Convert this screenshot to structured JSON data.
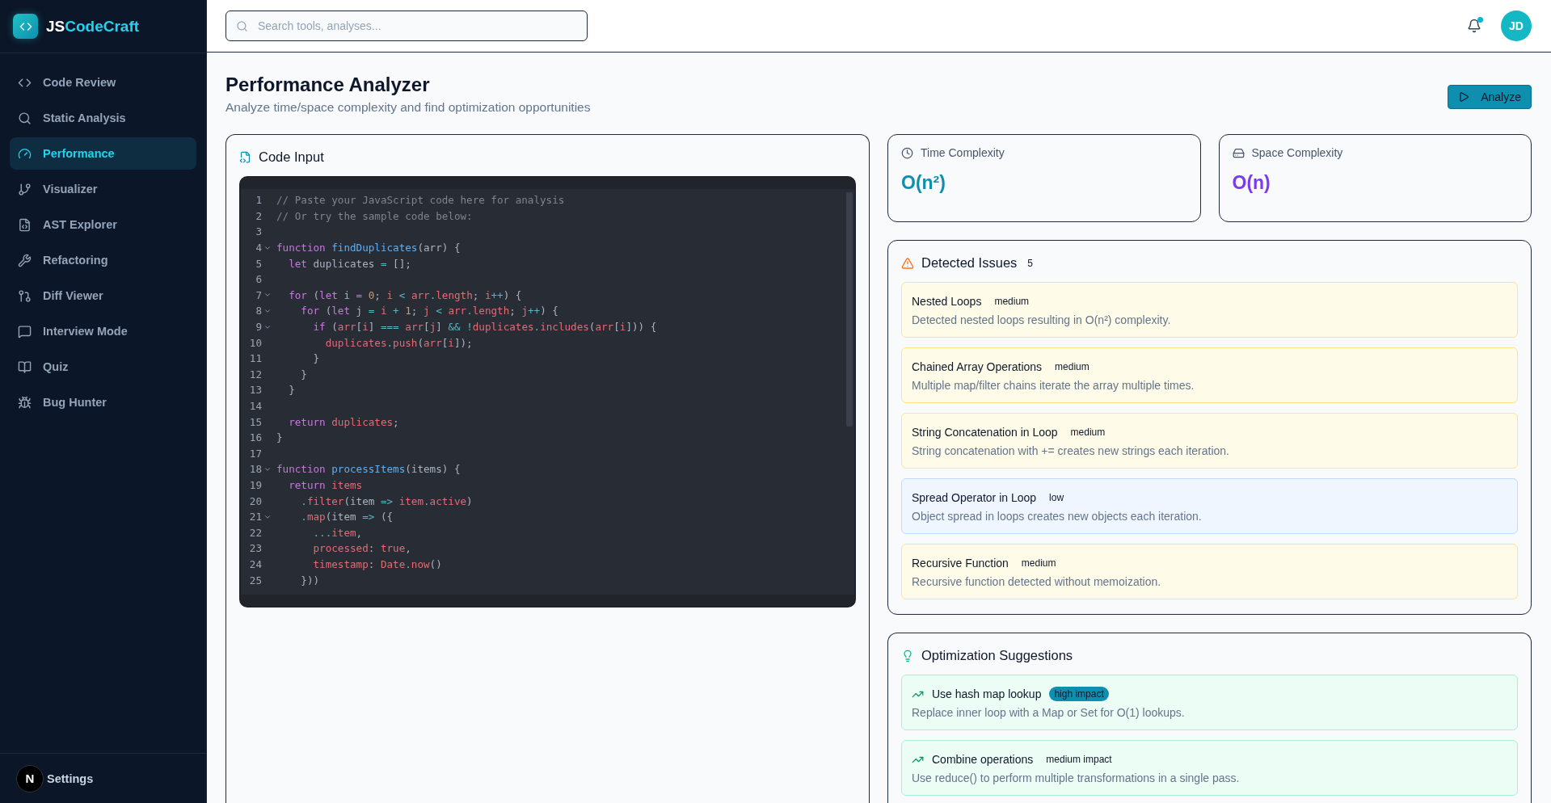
{
  "brand": {
    "prefix": "JS",
    "name": "CodeCraft"
  },
  "nav": [
    {
      "label": "Code Review",
      "selected": false
    },
    {
      "label": "Static Analysis",
      "selected": false
    },
    {
      "label": "Performance",
      "selected": true
    },
    {
      "label": "Visualizer",
      "selected": false
    },
    {
      "label": "AST Explorer",
      "selected": false
    },
    {
      "label": "Refactoring",
      "selected": false
    },
    {
      "label": "Diff Viewer",
      "selected": false
    },
    {
      "label": "Interview Mode",
      "selected": false
    },
    {
      "label": "Quiz",
      "selected": false
    },
    {
      "label": "Bug Hunter",
      "selected": false
    }
  ],
  "settings": {
    "label": "Settings",
    "badge": "N"
  },
  "search": {
    "placeholder": "Search tools, analyses..."
  },
  "notifications": {
    "unread": true
  },
  "avatar": "JD",
  "page": {
    "title": "Performance Analyzer",
    "subtitle": "Analyze time/space complexity and find optimization opportunities",
    "action": "Analyze"
  },
  "code_input": {
    "title": "Code Input",
    "lines": [
      {
        "number": "1",
        "fold": false,
        "tokens": [
          {
            "kind": "c",
            "text": "// Paste your JavaScript code here for analysis"
          }
        ]
      },
      {
        "number": "2",
        "fold": false,
        "tokens": [
          {
            "kind": "c",
            "text": "// Or try the sample code below:"
          }
        ]
      },
      {
        "number": "3",
        "fold": false
      },
      {
        "number": "4",
        "fold": true,
        "tokens": [
          {
            "kind": "k",
            "text": "function "
          },
          {
            "kind": "f",
            "text": "findDuplicates"
          },
          {
            "kind": "p",
            "text": "(arr) {"
          }
        ]
      },
      {
        "number": "5",
        "fold": false,
        "tokens": [
          {
            "kind": "k",
            "text": "  let"
          },
          {
            "kind": "p",
            "text": " duplicates "
          },
          {
            "kind": "o",
            "text": "="
          },
          {
            "kind": "p",
            "text": " [];"
          }
        ]
      },
      {
        "number": "6",
        "fold": false
      },
      {
        "number": "7",
        "fold": true,
        "tokens": [
          {
            "kind": "k",
            "text": "  for"
          },
          {
            "kind": "p",
            "text": " ("
          },
          {
            "kind": "k",
            "text": "let"
          },
          {
            "kind": "p",
            "text": " i "
          },
          {
            "kind": "o",
            "text": "="
          },
          {
            "kind": "n",
            "text": " 0"
          },
          {
            "kind": "p",
            "text": "; "
          },
          {
            "kind": "v",
            "text": "i"
          },
          {
            "kind": "o",
            "text": " < "
          },
          {
            "kind": "v",
            "text": "arr"
          },
          {
            "kind": "o",
            "text": "."
          },
          {
            "kind": "v",
            "text": "length"
          },
          {
            "kind": "p",
            "text": "; "
          },
          {
            "kind": "v",
            "text": "i"
          },
          {
            "kind": "o",
            "text": "++"
          },
          {
            "kind": "p",
            "text": ") {"
          }
        ]
      },
      {
        "number": "8",
        "fold": true,
        "tokens": [
          {
            "kind": "k",
            "text": "    for"
          },
          {
            "kind": "p",
            "text": " ("
          },
          {
            "kind": "k",
            "text": "let"
          },
          {
            "kind": "p",
            "text": " j "
          },
          {
            "kind": "o",
            "text": "="
          },
          {
            "kind": "v",
            "text": " i"
          },
          {
            "kind": "o",
            "text": " + "
          },
          {
            "kind": "n",
            "text": "1"
          },
          {
            "kind": "p",
            "text": "; "
          },
          {
            "kind": "v",
            "text": "j"
          },
          {
            "kind": "o",
            "text": " < "
          },
          {
            "kind": "v",
            "text": "arr"
          },
          {
            "kind": "o",
            "text": "."
          },
          {
            "kind": "v",
            "text": "length"
          },
          {
            "kind": "p",
            "text": "; "
          },
          {
            "kind": "v",
            "text": "j"
          },
          {
            "kind": "o",
            "text": "++"
          },
          {
            "kind": "p",
            "text": ") {"
          }
        ]
      },
      {
        "number": "9",
        "fold": true,
        "tokens": [
          {
            "kind": "k",
            "text": "      if"
          },
          {
            "kind": "p",
            "text": " ("
          },
          {
            "kind": "v",
            "text": "arr"
          },
          {
            "kind": "p",
            "text": "["
          },
          {
            "kind": "v",
            "text": "i"
          },
          {
            "kind": "p",
            "text": "] "
          },
          {
            "kind": "o",
            "text": "=== "
          },
          {
            "kind": "v",
            "text": "arr"
          },
          {
            "kind": "p",
            "text": "["
          },
          {
            "kind": "v",
            "text": "j"
          },
          {
            "kind": "p",
            "text": "] "
          },
          {
            "kind": "o",
            "text": "&& !"
          },
          {
            "kind": "v",
            "text": "duplicates"
          },
          {
            "kind": "o",
            "text": "."
          },
          {
            "kind": "v",
            "text": "includes"
          },
          {
            "kind": "p",
            "text": "("
          },
          {
            "kind": "v",
            "text": "arr"
          },
          {
            "kind": "p",
            "text": "["
          },
          {
            "kind": "v",
            "text": "i"
          },
          {
            "kind": "p",
            "text": "])) {"
          }
        ]
      },
      {
        "number": "10",
        "fold": false,
        "tokens": [
          {
            "kind": "v",
            "text": "        duplicates"
          },
          {
            "kind": "o",
            "text": "."
          },
          {
            "kind": "v",
            "text": "push"
          },
          {
            "kind": "p",
            "text": "("
          },
          {
            "kind": "v",
            "text": "arr"
          },
          {
            "kind": "p",
            "text": "["
          },
          {
            "kind": "v",
            "text": "i"
          },
          {
            "kind": "p",
            "text": "]);"
          }
        ]
      },
      {
        "number": "11",
        "fold": false,
        "tokens": [
          {
            "kind": "p",
            "text": "      }"
          }
        ]
      },
      {
        "number": "12",
        "fold": false,
        "tokens": [
          {
            "kind": "p",
            "text": "    }"
          }
        ]
      },
      {
        "number": "13",
        "fold": false,
        "tokens": [
          {
            "kind": "p",
            "text": "  }"
          }
        ]
      },
      {
        "number": "14",
        "fold": false
      },
      {
        "number": "15",
        "fold": false,
        "tokens": [
          {
            "kind": "k",
            "text": "  return "
          },
          {
            "kind": "v",
            "text": "duplicates"
          },
          {
            "kind": "p",
            "text": ";"
          }
        ]
      },
      {
        "number": "16",
        "fold": false,
        "tokens": [
          {
            "kind": "p",
            "text": "}"
          }
        ]
      },
      {
        "number": "17",
        "fold": false
      },
      {
        "number": "18",
        "fold": true,
        "tokens": [
          {
            "kind": "k",
            "text": "function "
          },
          {
            "kind": "f",
            "text": "processItems"
          },
          {
            "kind": "p",
            "text": "(items) {"
          }
        ]
      },
      {
        "number": "19",
        "fold": false,
        "tokens": [
          {
            "kind": "k",
            "text": "  return "
          },
          {
            "kind": "v",
            "text": "items"
          }
        ]
      },
      {
        "number": "20",
        "fold": false,
        "tokens": [
          {
            "kind": "o",
            "text": "    ."
          },
          {
            "kind": "v",
            "text": "filter"
          },
          {
            "kind": "p",
            "text": "(item "
          },
          {
            "kind": "o",
            "text": "=> "
          },
          {
            "kind": "v",
            "text": "item"
          },
          {
            "kind": "o",
            "text": "."
          },
          {
            "kind": "v",
            "text": "active"
          },
          {
            "kind": "p",
            "text": ")"
          }
        ]
      },
      {
        "number": "21",
        "fold": true,
        "tokens": [
          {
            "kind": "o",
            "text": "    ."
          },
          {
            "kind": "v",
            "text": "map"
          },
          {
            "kind": "p",
            "text": "(item "
          },
          {
            "kind": "o",
            "text": "=>"
          },
          {
            "kind": "p",
            "text": " ({"
          }
        ]
      },
      {
        "number": "22",
        "fold": false,
        "tokens": [
          {
            "kind": "o",
            "text": "      ..."
          },
          {
            "kind": "v",
            "text": "item"
          },
          {
            "kind": "p",
            "text": ","
          }
        ]
      },
      {
        "number": "23",
        "fold": false,
        "tokens": [
          {
            "kind": "v",
            "text": "      processed"
          },
          {
            "kind": "p",
            "text": ": "
          },
          {
            "kind": "v",
            "text": "true"
          },
          {
            "kind": "p",
            "text": ","
          }
        ]
      },
      {
        "number": "24",
        "fold": false,
        "tokens": [
          {
            "kind": "v",
            "text": "      timestamp"
          },
          {
            "kind": "p",
            "text": ": "
          },
          {
            "kind": "v",
            "text": "Date"
          },
          {
            "kind": "o",
            "text": "."
          },
          {
            "kind": "v",
            "text": "now"
          },
          {
            "kind": "p",
            "text": "()"
          }
        ]
      },
      {
        "number": "25",
        "fold": false,
        "tokens": [
          {
            "kind": "p",
            "text": "    }))"
          }
        ]
      }
    ]
  },
  "complexity": [
    {
      "label": "Time Complexity",
      "value": "O(n²)",
      "kind": "time"
    },
    {
      "label": "Space Complexity",
      "value": "O(n)",
      "kind": "space"
    }
  ],
  "issues": {
    "title": "Detected Issues",
    "count": "5",
    "items": [
      {
        "title": "Nested Loops",
        "severity": "medium",
        "description": "Detected nested loops resulting in O(n²) complexity."
      },
      {
        "title": "Chained Array Operations",
        "severity": "medium",
        "description": "Multiple map/filter chains iterate the array multiple times."
      },
      {
        "title": "String Concatenation in Loop",
        "severity": "medium",
        "description": "String concatenation with += creates new strings each iteration."
      },
      {
        "title": "Spread Operator in Loop",
        "severity": "low",
        "description": "Object spread in loops creates new objects each iteration."
      },
      {
        "title": "Recursive Function",
        "severity": "medium",
        "description": "Recursive function detected without memoization."
      }
    ]
  },
  "suggestions": {
    "title": "Optimization Suggestions",
    "items": [
      {
        "title": "Use hash map lookup",
        "impact": "high impact",
        "highlighted": true,
        "description": "Replace inner loop with a Map or Set for O(1) lookups."
      },
      {
        "title": "Combine operations",
        "impact": "medium impact",
        "highlighted": false,
        "description": "Use reduce() to perform multiple transformations in a single pass."
      }
    ]
  }
}
